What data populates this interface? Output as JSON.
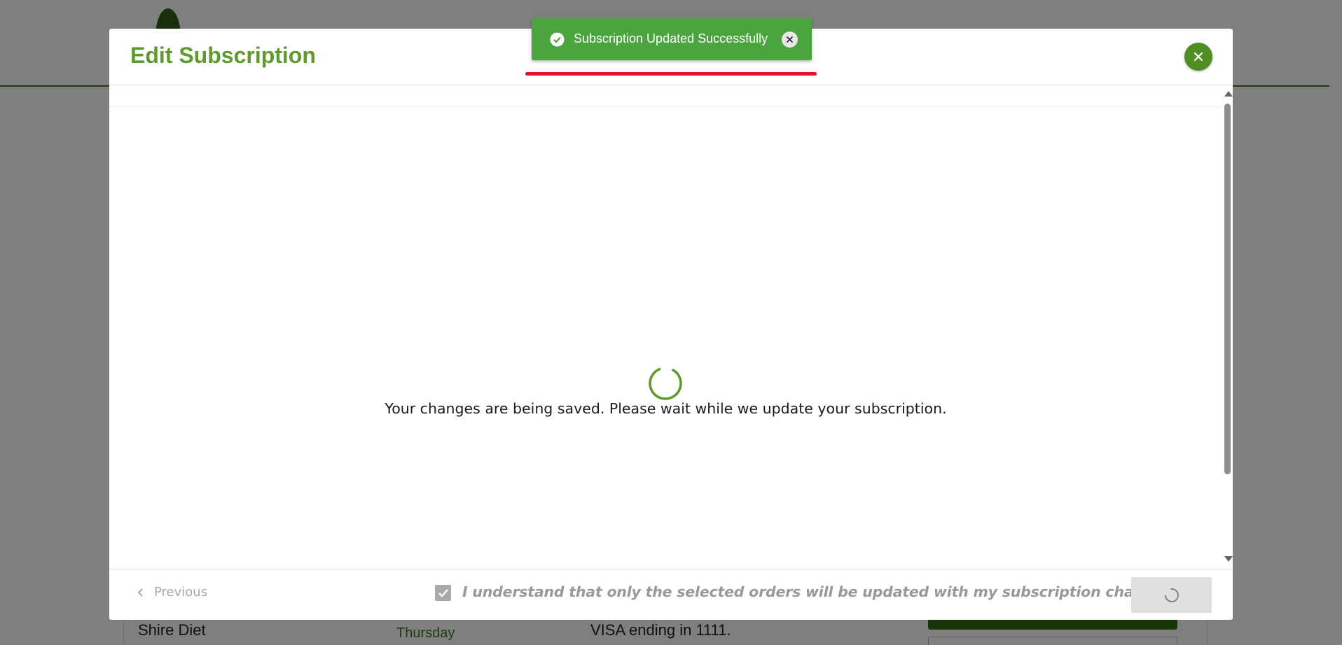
{
  "modal": {
    "title": "Edit Subscription",
    "saving_message": "Your changes are being saved. Please wait while we update your subscription.",
    "close_icon": "close-icon"
  },
  "footer": {
    "previous_label": "Previous",
    "agree_label": "I understand that only the selected orders will be updated with my subscription changes.",
    "agree_checked": true
  },
  "toast": {
    "message": "Subscription Updated Successfully",
    "icon": "check-circle-icon",
    "close_icon": "close-icon"
  },
  "background": {
    "diet_name": "Shire Diet",
    "delivery_day": "Thursday",
    "payment_method": "VISA ending in 1111."
  },
  "colors": {
    "brand_green": "#4f8e22",
    "title_green": "#5f9a2d",
    "toast_green": "#4aa53f",
    "highlight_red": "#e3102a"
  }
}
